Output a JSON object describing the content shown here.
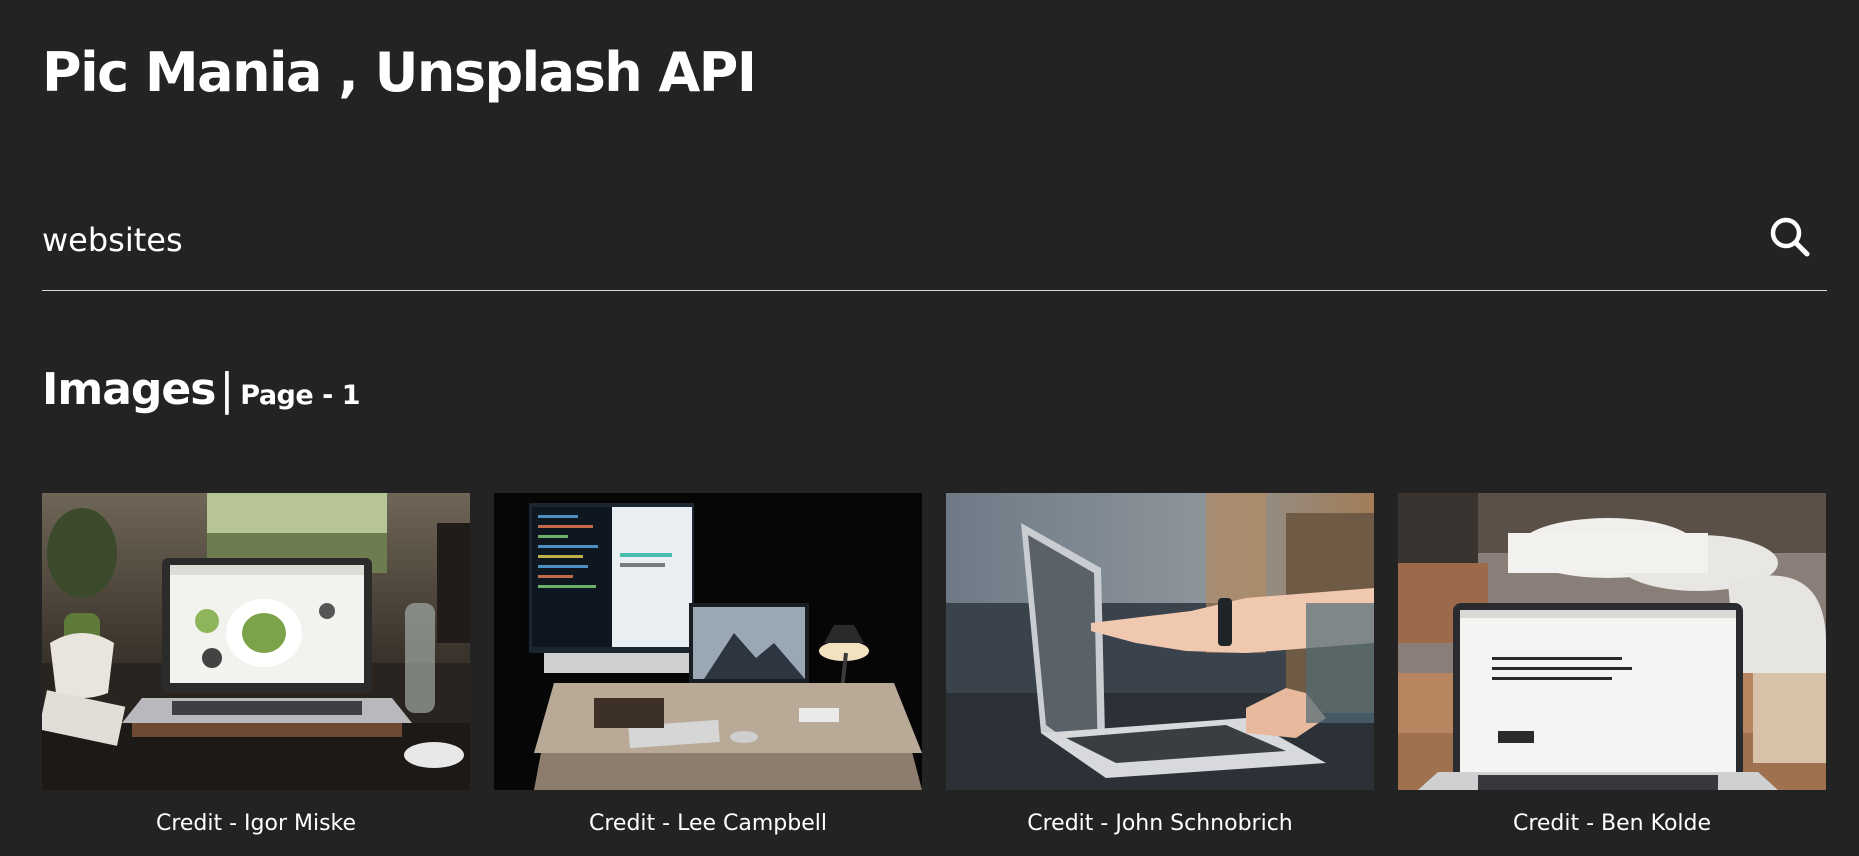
{
  "app": {
    "title": "Pic Mania , Unsplash API"
  },
  "search": {
    "value": "websites",
    "icon": "search-icon"
  },
  "section": {
    "title": "Images",
    "separator": "|",
    "page_label": "Page - 1"
  },
  "images": [
    {
      "credit": "Credit - Igor Miske"
    },
    {
      "credit": "Credit - Lee Campbell"
    },
    {
      "credit": "Credit - John Schnobrich"
    },
    {
      "credit": "Credit - Ben Kolde"
    }
  ],
  "colors": {
    "background": "#232323",
    "text": "#ffffff",
    "underline": "#d8d8d8"
  }
}
